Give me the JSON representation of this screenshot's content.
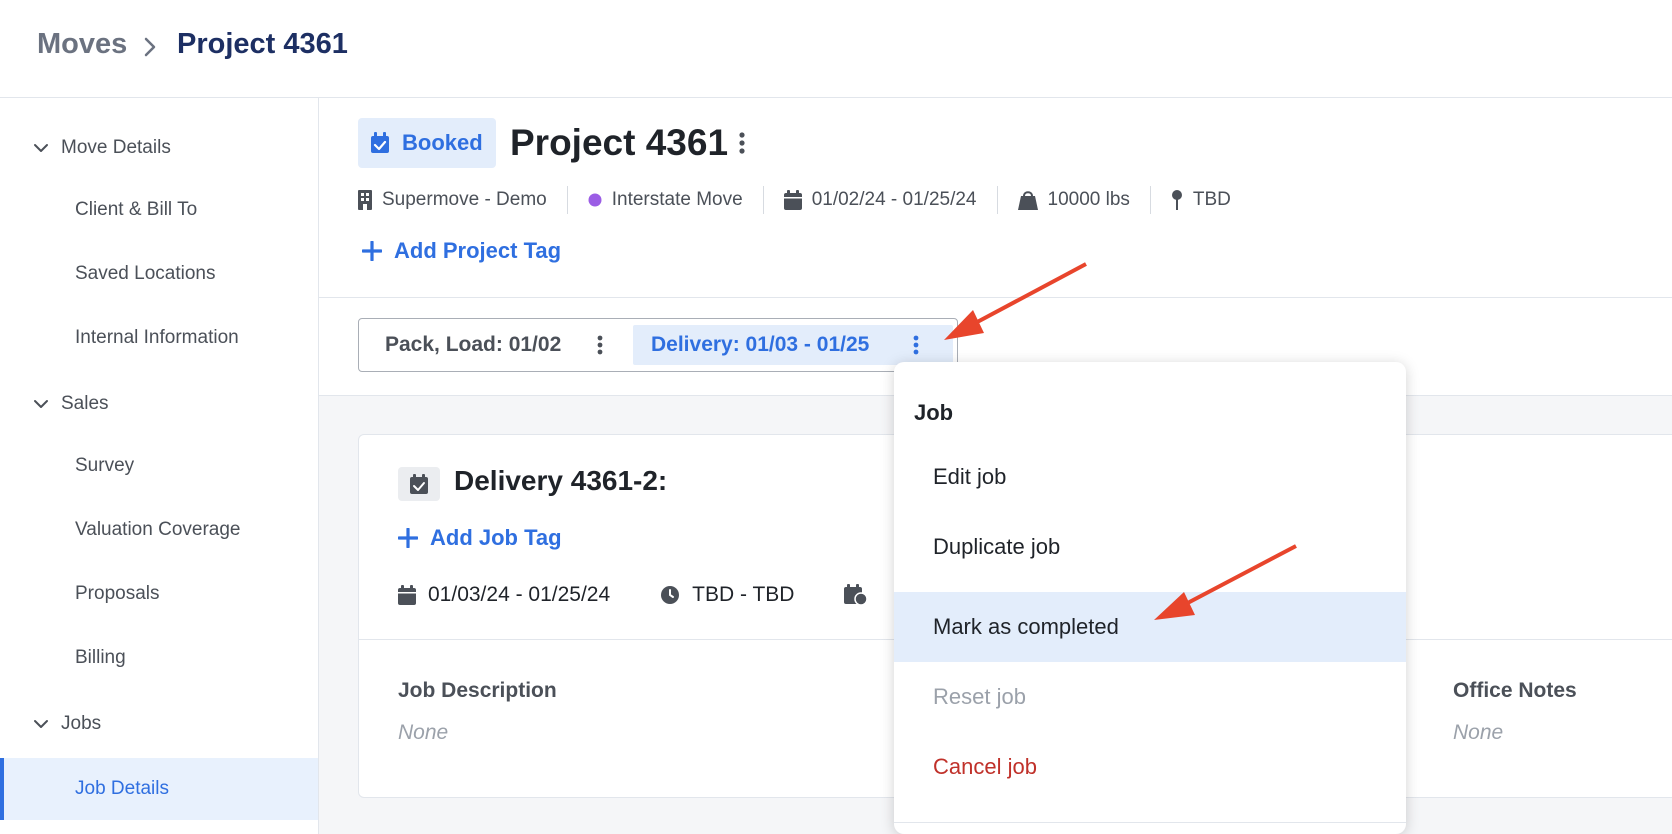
{
  "breadcrumb": {
    "root": "Moves",
    "current": "Project 4361"
  },
  "sidebar": {
    "sections": [
      {
        "label": "Move Details",
        "items": [
          "Client & Bill To",
          "Saved Locations",
          "Internal Information"
        ]
      },
      {
        "label": "Sales",
        "items": [
          "Survey",
          "Valuation Coverage",
          "Proposals",
          "Billing"
        ]
      },
      {
        "label": "Jobs",
        "items": [
          "Job Details"
        ]
      }
    ],
    "active_item": "Job Details"
  },
  "project": {
    "status": "Booked",
    "title": "Project 4361",
    "meta": {
      "organization": "Supermove - Demo",
      "move_type": "Interstate Move",
      "move_type_color": "#9b5de5",
      "dates": "01/02/24 - 01/25/24",
      "weight": "10000 lbs",
      "location": "TBD"
    },
    "add_tag_label": "Add Project Tag"
  },
  "job_tabs": [
    {
      "label": "Pack, Load: 01/02",
      "selected": false
    },
    {
      "label": "Delivery: 01/03 - 01/25",
      "selected": true
    }
  ],
  "job_card": {
    "title": "Delivery 4361-2:",
    "add_tag_label": "Add Job Tag",
    "dates": "01/03/24 - 01/25/24",
    "time": "TBD - TBD",
    "fields": [
      {
        "label": "Job Description",
        "value": "None"
      },
      {
        "label": "Office Notes",
        "value": "None"
      }
    ]
  },
  "dropdown": {
    "header": "Job",
    "items": [
      {
        "label": "Edit job",
        "state": "normal"
      },
      {
        "label": "Duplicate job",
        "state": "normal"
      },
      {
        "label": "Mark as completed",
        "state": "hover"
      },
      {
        "label": "Reset job",
        "state": "disabled"
      },
      {
        "label": "Cancel job",
        "state": "danger"
      }
    ]
  },
  "colors": {
    "accent": "#2f6fe0",
    "accent_bg": "#e3edfb",
    "danger": "#c0312a",
    "annotation_arrow": "#e8452c"
  },
  "icons": {
    "breadcrumb_separator": "chevron-right-icon",
    "status": "calendar-check-icon",
    "project_menu": "vertical-dots-icon",
    "organization": "building-icon",
    "move_type": "status-dot-icon",
    "dates": "calendar-icon",
    "weight": "weight-bag-icon",
    "location": "map-pin-icon",
    "add_tag": "plus-icon",
    "job_time": "clock-icon"
  }
}
